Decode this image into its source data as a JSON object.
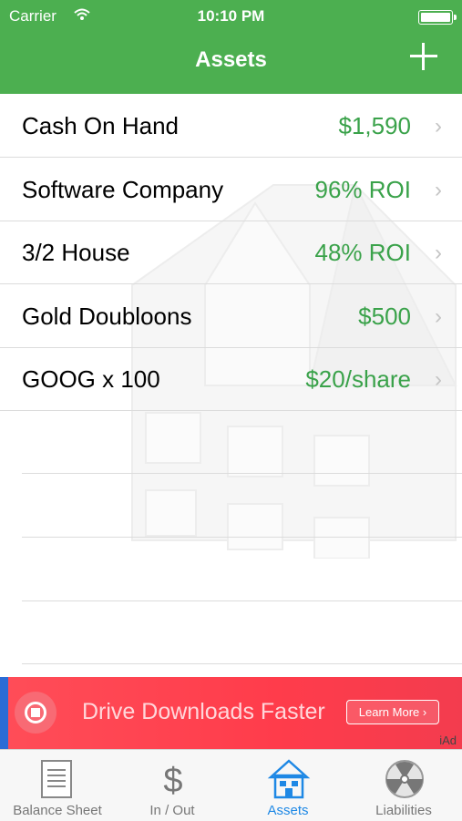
{
  "status_bar": {
    "carrier": "Carrier",
    "time": "10:10 PM"
  },
  "header": {
    "title": "Assets"
  },
  "assets": [
    {
      "name": "Cash On Hand",
      "value": "$1,590"
    },
    {
      "name": "Software Company",
      "value": "96% ROI"
    },
    {
      "name": "3/2 House",
      "value": "48% ROI"
    },
    {
      "name": "Gold Doubloons",
      "value": "$500"
    },
    {
      "name": "GOOG x 100",
      "value": "$20/share"
    }
  ],
  "ad": {
    "headline": "Drive Downloads Faster",
    "cta": "Learn More ›",
    "badge": "iAd"
  },
  "tabs": [
    {
      "label": "Balance Sheet",
      "icon": "document-icon"
    },
    {
      "label": "In / Out",
      "icon": "dollar-icon"
    },
    {
      "label": "Assets",
      "icon": "house-icon"
    },
    {
      "label": "Liabilities",
      "icon": "radiation-icon"
    }
  ],
  "colors": {
    "header": "#4caf50",
    "value_green": "#3aa24a",
    "active_tab": "#1e88e5",
    "ad_red": "#ff4d58"
  }
}
